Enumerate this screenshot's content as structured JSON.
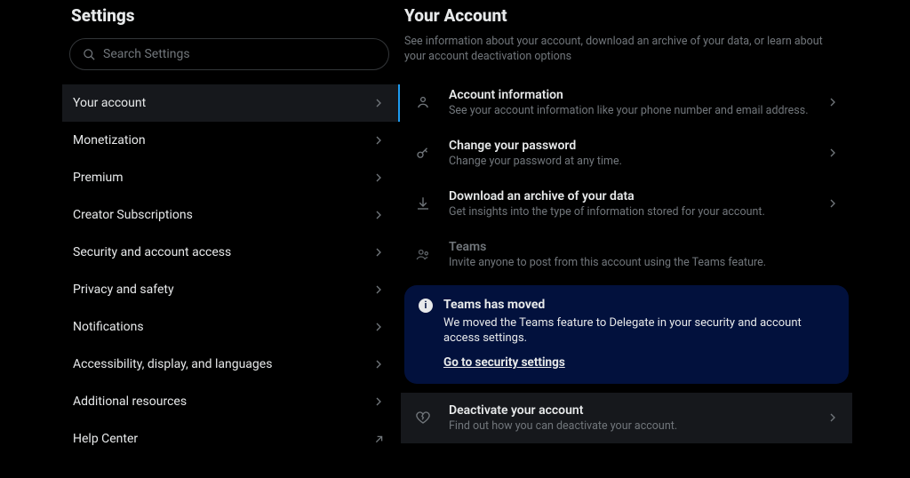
{
  "sidebar": {
    "title": "Settings",
    "search_placeholder": "Search Settings",
    "items": [
      {
        "label": "Your account",
        "active": true,
        "kind": "internal"
      },
      {
        "label": "Monetization",
        "kind": "internal"
      },
      {
        "label": "Premium",
        "kind": "internal"
      },
      {
        "label": "Creator Subscriptions",
        "kind": "internal"
      },
      {
        "label": "Security and account access",
        "kind": "internal"
      },
      {
        "label": "Privacy and safety",
        "kind": "internal"
      },
      {
        "label": "Notifications",
        "kind": "internal"
      },
      {
        "label": "Accessibility, display, and languages",
        "kind": "internal"
      },
      {
        "label": "Additional resources",
        "kind": "internal"
      },
      {
        "label": "Help Center",
        "kind": "external"
      }
    ]
  },
  "main": {
    "title": "Your Account",
    "description": "See information about your account, download an archive of your data, or learn about your account deactivation options",
    "options": [
      {
        "title": "Account information",
        "subtitle": "See your account information like your phone number and email address."
      },
      {
        "title": "Change your password",
        "subtitle": "Change your password at any time."
      },
      {
        "title": "Download an archive of your data",
        "subtitle": "Get insights into the type of information stored for your account."
      },
      {
        "title": "Teams",
        "subtitle": "Invite anyone to post from this account using the Teams feature."
      }
    ],
    "notice": {
      "title": "Teams has moved",
      "body": "We moved the Teams feature to Delegate in your security and account access settings.",
      "link": "Go to security settings"
    },
    "deactivate": {
      "title": "Deactivate your account",
      "subtitle": "Find out how you can deactivate your account."
    }
  }
}
